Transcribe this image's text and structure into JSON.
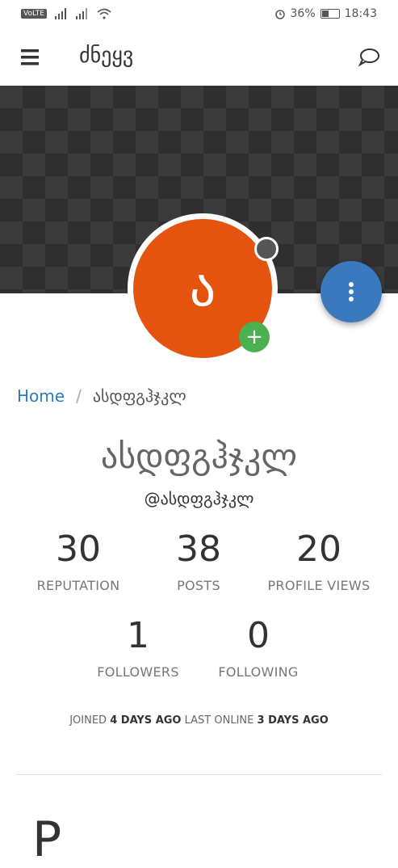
{
  "status_bar": {
    "network": "VoLTE",
    "battery": "36%",
    "time": "18:43",
    "battery_level": 0.36
  },
  "header": {
    "title": "ძნეყვ"
  },
  "profile": {
    "avatar_letter": "ა",
    "full_name": "ასდფგჰჯკლ",
    "username": "@ასდფგჰჯკლ"
  },
  "breadcrumb": {
    "home": "Home",
    "separator": "/",
    "current": "ასდფგჰჯკლ"
  },
  "stats": [
    {
      "value": "30",
      "label": "REPUTATION"
    },
    {
      "value": "38",
      "label": "POSTS"
    },
    {
      "value": "20",
      "label": "PROFILE VIEWS"
    },
    {
      "value": "1",
      "label": "FOLLOWERS"
    },
    {
      "value": "0",
      "label": "FOLLOWING"
    }
  ],
  "joined": {
    "joined_label": "JOINED",
    "joined_value": "4 DAYS AGO",
    "online_label": "LAST ONLINE",
    "online_value": "3 DAYS AGO"
  },
  "section": {
    "heading_partial": "P"
  },
  "colors": {
    "avatar": "#e5540e",
    "fab": "#3a79bd",
    "add": "#4caf50",
    "link": "#2d7bbf"
  }
}
